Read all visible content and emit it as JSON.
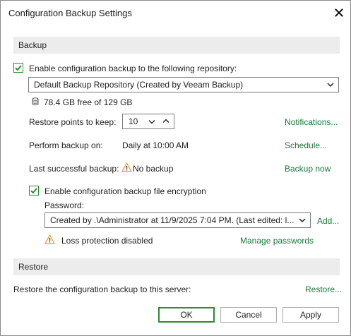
{
  "window": {
    "title": "Configuration Backup Settings"
  },
  "backup": {
    "section_label": "Backup",
    "enable_label": "Enable configuration backup to the following repository:",
    "enable_checked": true,
    "repository": "Default Backup Repository (Created by Veeam Backup)",
    "free_space": "78.4 GB free of 129 GB",
    "restore_points_label": "Restore points to keep:",
    "restore_points_value": "10",
    "notifications_link": "Notifications...",
    "perform_label": "Perform backup on:",
    "perform_value": "Daily at 10:00 AM",
    "schedule_link": "Schedule...",
    "last_label": "Last successful backup:",
    "last_value": "No backup",
    "backup_now_link": "Backup now",
    "encryption_label": "Enable configuration backup file encryption",
    "encryption_checked": true,
    "password_label": "Password:",
    "password_value": "Created by .\\Administrator at 11/9/2025 7:04 PM. (Last edited: l...",
    "add_link": "Add...",
    "loss_protection": "Loss protection disabled",
    "manage_passwords_link": "Manage passwords"
  },
  "restore": {
    "section_label": "Restore",
    "restore_label": "Restore the configuration backup to this server:",
    "restore_link": "Restore..."
  },
  "buttons": {
    "ok": "OK",
    "cancel": "Cancel",
    "apply": "Apply"
  },
  "colors": {
    "accent": "#2e8b2e",
    "link": "#157a38",
    "warning": "#e0a020"
  },
  "icons": {
    "close": "close-icon",
    "check": "checkmark-icon",
    "database": "database-icon",
    "warning": "warning-icon",
    "dropdown": "chevron-down-icon",
    "spin_down": "chevron-down-icon",
    "spin_up": "chevron-up-icon"
  }
}
